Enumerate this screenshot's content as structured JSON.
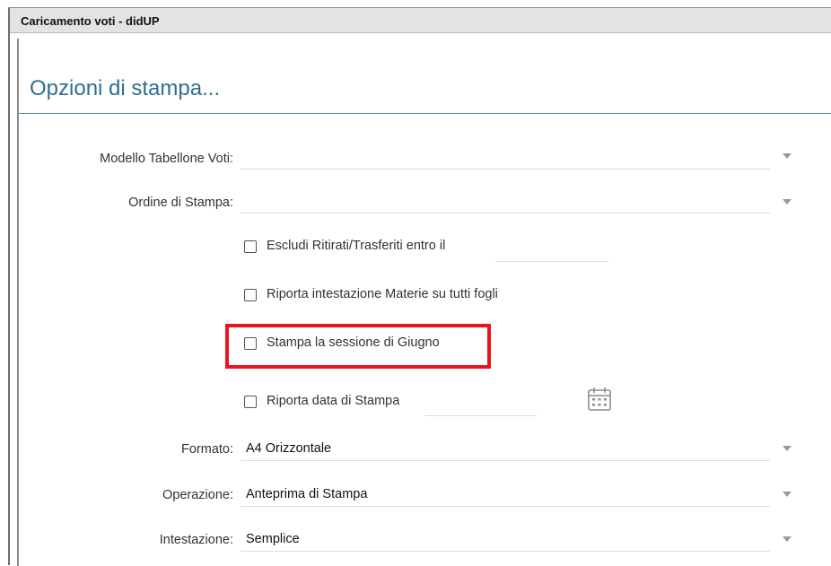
{
  "window": {
    "title": "Caricamento voti - didUP"
  },
  "dialog": {
    "title": "Opzioni di stampa..."
  },
  "fields": {
    "modello": {
      "label": "Modello Tabellone Voti:",
      "value": ""
    },
    "ordine": {
      "label": "Ordine di Stampa:",
      "value": ""
    },
    "formato": {
      "label": "Formato:",
      "value": "A4 Orizzontale"
    },
    "operazione": {
      "label": "Operazione:",
      "value": "Anteprima di Stampa"
    },
    "intestazione": {
      "label": "Intestazione:",
      "value": "Semplice"
    }
  },
  "checkboxes": {
    "escludi": {
      "label": "Escludi Ritirati/Trasferiti entro il",
      "checked": false
    },
    "riporta_materie": {
      "label": "Riporta intestazione Materie su tutti fogli",
      "checked": false
    },
    "sessione_giugno": {
      "label": "Stampa la sessione di Giugno",
      "checked": false
    },
    "riporta_data": {
      "label": "Riporta data di Stampa",
      "checked": false
    }
  },
  "icons": {
    "dropdown": "chevron-down-icon",
    "calendar": "calendar-icon"
  },
  "colors": {
    "accent": "#2f6e8f",
    "highlight": "#e8151e"
  }
}
